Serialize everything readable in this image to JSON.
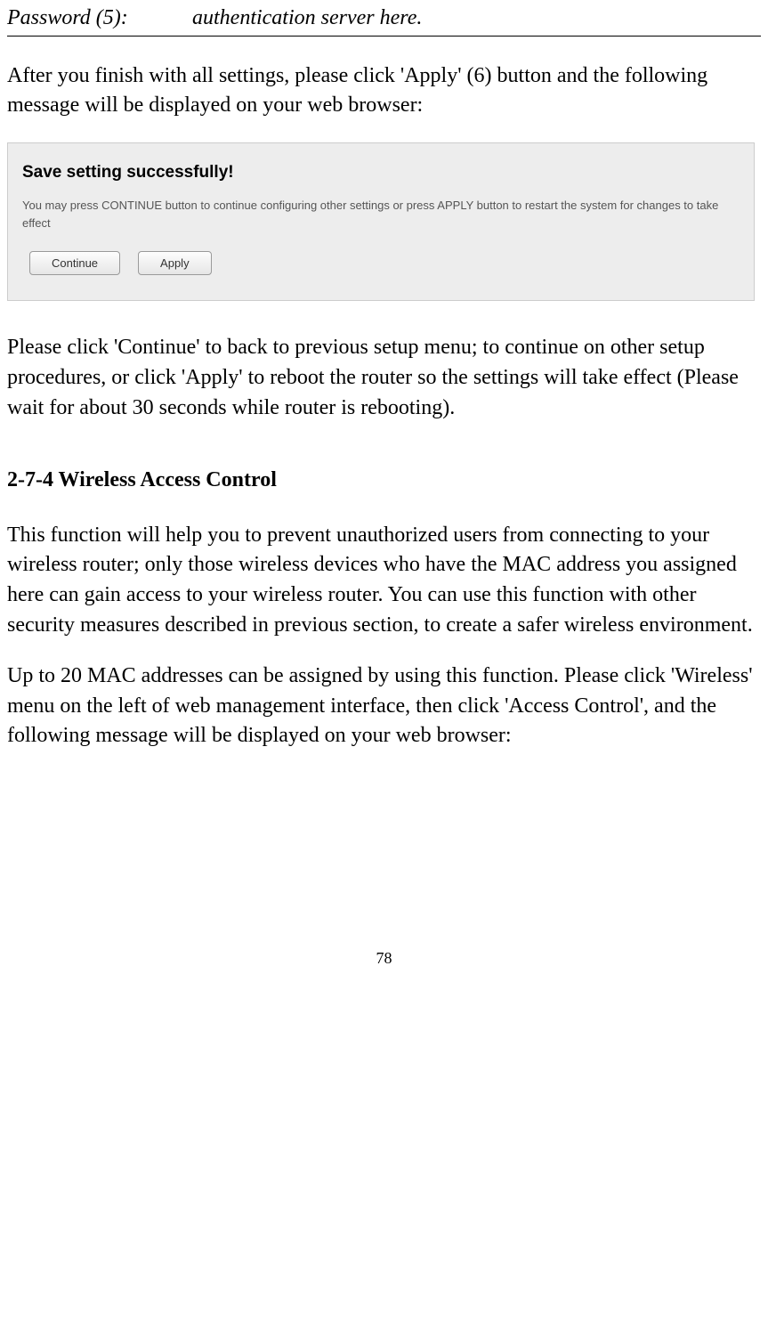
{
  "topRow": {
    "label": "Password (5):",
    "value": "authentication server here."
  },
  "para1": "After you finish with all settings, please click 'Apply' (6) button and the following message will be displayed on your web browser:",
  "screenshot": {
    "title": "Save setting successfully!",
    "description": "You may press CONTINUE button to continue configuring other settings or press APPLY button to restart the system for changes to take effect",
    "continueLabel": "Continue",
    "applyLabel": "Apply"
  },
  "para2": "Please click 'Continue' to back to previous setup menu; to continue on other setup procedures, or click 'Apply' to reboot the router so the settings will take effect (Please wait for about 30 seconds while router is rebooting).",
  "sectionHeading": "2-7-4 Wireless Access Control",
  "para3": "This function will help you to prevent unauthorized users from connecting to your wireless router; only those wireless devices who have the MAC address you assigned here can gain access to your wireless router. You can use this function with other security measures described in previous section, to create a safer wireless environment.",
  "para4": "Up to 20 MAC addresses can be assigned by using this function. Please click 'Wireless' menu on the left of web management interface, then click 'Access Control', and the following message will be displayed on your web browser:",
  "pageNumber": "78"
}
